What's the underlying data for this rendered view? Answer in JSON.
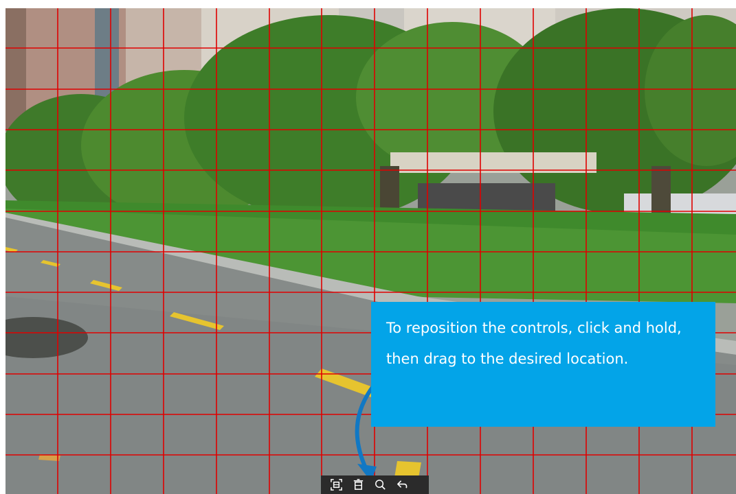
{
  "tooltip": {
    "text": "To reposition the controls, click and hold, then drag to the desired location."
  },
  "grid": {
    "color": "#e00000"
  },
  "toolbar": {
    "buttons": [
      {
        "icon": "fit-screen-icon",
        "title": "Fit"
      },
      {
        "icon": "delete-icon",
        "title": "Delete"
      },
      {
        "icon": "zoom-icon",
        "title": "Zoom"
      },
      {
        "icon": "undo-icon",
        "title": "Undo"
      }
    ]
  },
  "colors": {
    "tooltip_bg": "#03a4e8",
    "arrow": "#1178c4",
    "toolbar_bg": "#2b2b2b",
    "icon": "#ffffff"
  }
}
